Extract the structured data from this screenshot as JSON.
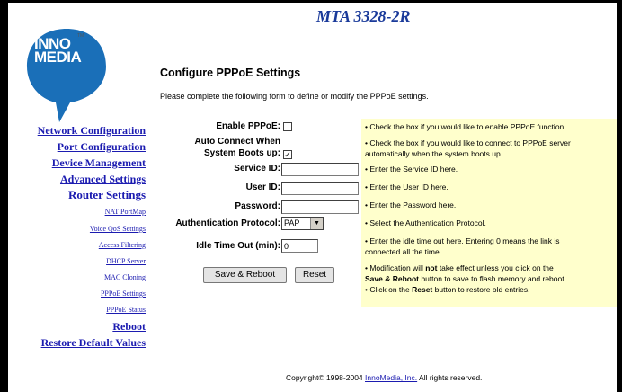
{
  "header": {
    "product": "MTA 3328-2R"
  },
  "logo": {
    "line1": "INNO",
    "line2": "MEDIA",
    "tm": "TM"
  },
  "page": {
    "title": "Configure PPPoE Settings",
    "intro": "Please complete the following form to define or modify the PPPoE settings."
  },
  "nav": {
    "network": "Network Configuration",
    "port": "Port Configuration",
    "device": "Device Management",
    "advanced": "Advanced Settings",
    "router": "Router Settings",
    "nat": "NAT PortMap",
    "voice": "Voice QoS Settings",
    "access": "Access Filtering",
    "dhcp": "DHCP Server",
    "mac": "MAC Cloning",
    "pppoe": "PPPoE Settings",
    "pppoe_status": "PPPoE Status",
    "reboot": "Reboot",
    "restore": "Restore Default Values"
  },
  "form": {
    "enable_label": "Enable PPPoE:",
    "enable_checked": false,
    "auto_label_1": "Auto Connect When",
    "auto_label_2": "System Boots up:",
    "auto_checked": true,
    "service_label": "Service ID:",
    "service_value": "",
    "user_label": "User ID:",
    "user_value": "",
    "password_label": "Password:",
    "password_value": "",
    "auth_label": "Authentication Protocol:",
    "auth_value": "PAP",
    "idle_label": "Idle Time Out (min):",
    "idle_value": "0",
    "save_button": "Save & Reboot",
    "reset_button": "Reset"
  },
  "help": {
    "enable": "•  Check the box if you would like to enable PPPoE function.",
    "auto_1": "•  Check the box if you would like to connect to PPPoE server",
    "auto_2": "automatically when the system boots up.",
    "service": "•  Enter the Service ID here.",
    "user": "•  Enter the User ID here.",
    "password": "•  Enter the Password here.",
    "auth": "•  Select the Authentication Protocol.",
    "idle_1": "•  Enter the idle time out here. Entering 0 means the link is",
    "idle_2": "connected all the time.",
    "mod_1a": "•  Modification will ",
    "mod_1b": "not",
    "mod_1c": " take effect unless you click on the",
    "mod_2a": "Save & Reboot",
    "mod_2b": " button to save to flash memory and reboot.",
    "reset_a": "•  Click on the ",
    "reset_b": "Reset",
    "reset_c": " button to restore old entries."
  },
  "footer": {
    "pre": "Copyright© 1998-2004 ",
    "link": "InnoMedia, Inc.",
    "post": "  All rights reserved."
  },
  "colors": {
    "link": "#1b1bb0",
    "help_bg": "#ffffcc",
    "logo": "#1a6fb8",
    "product": "#1a3a9a"
  }
}
